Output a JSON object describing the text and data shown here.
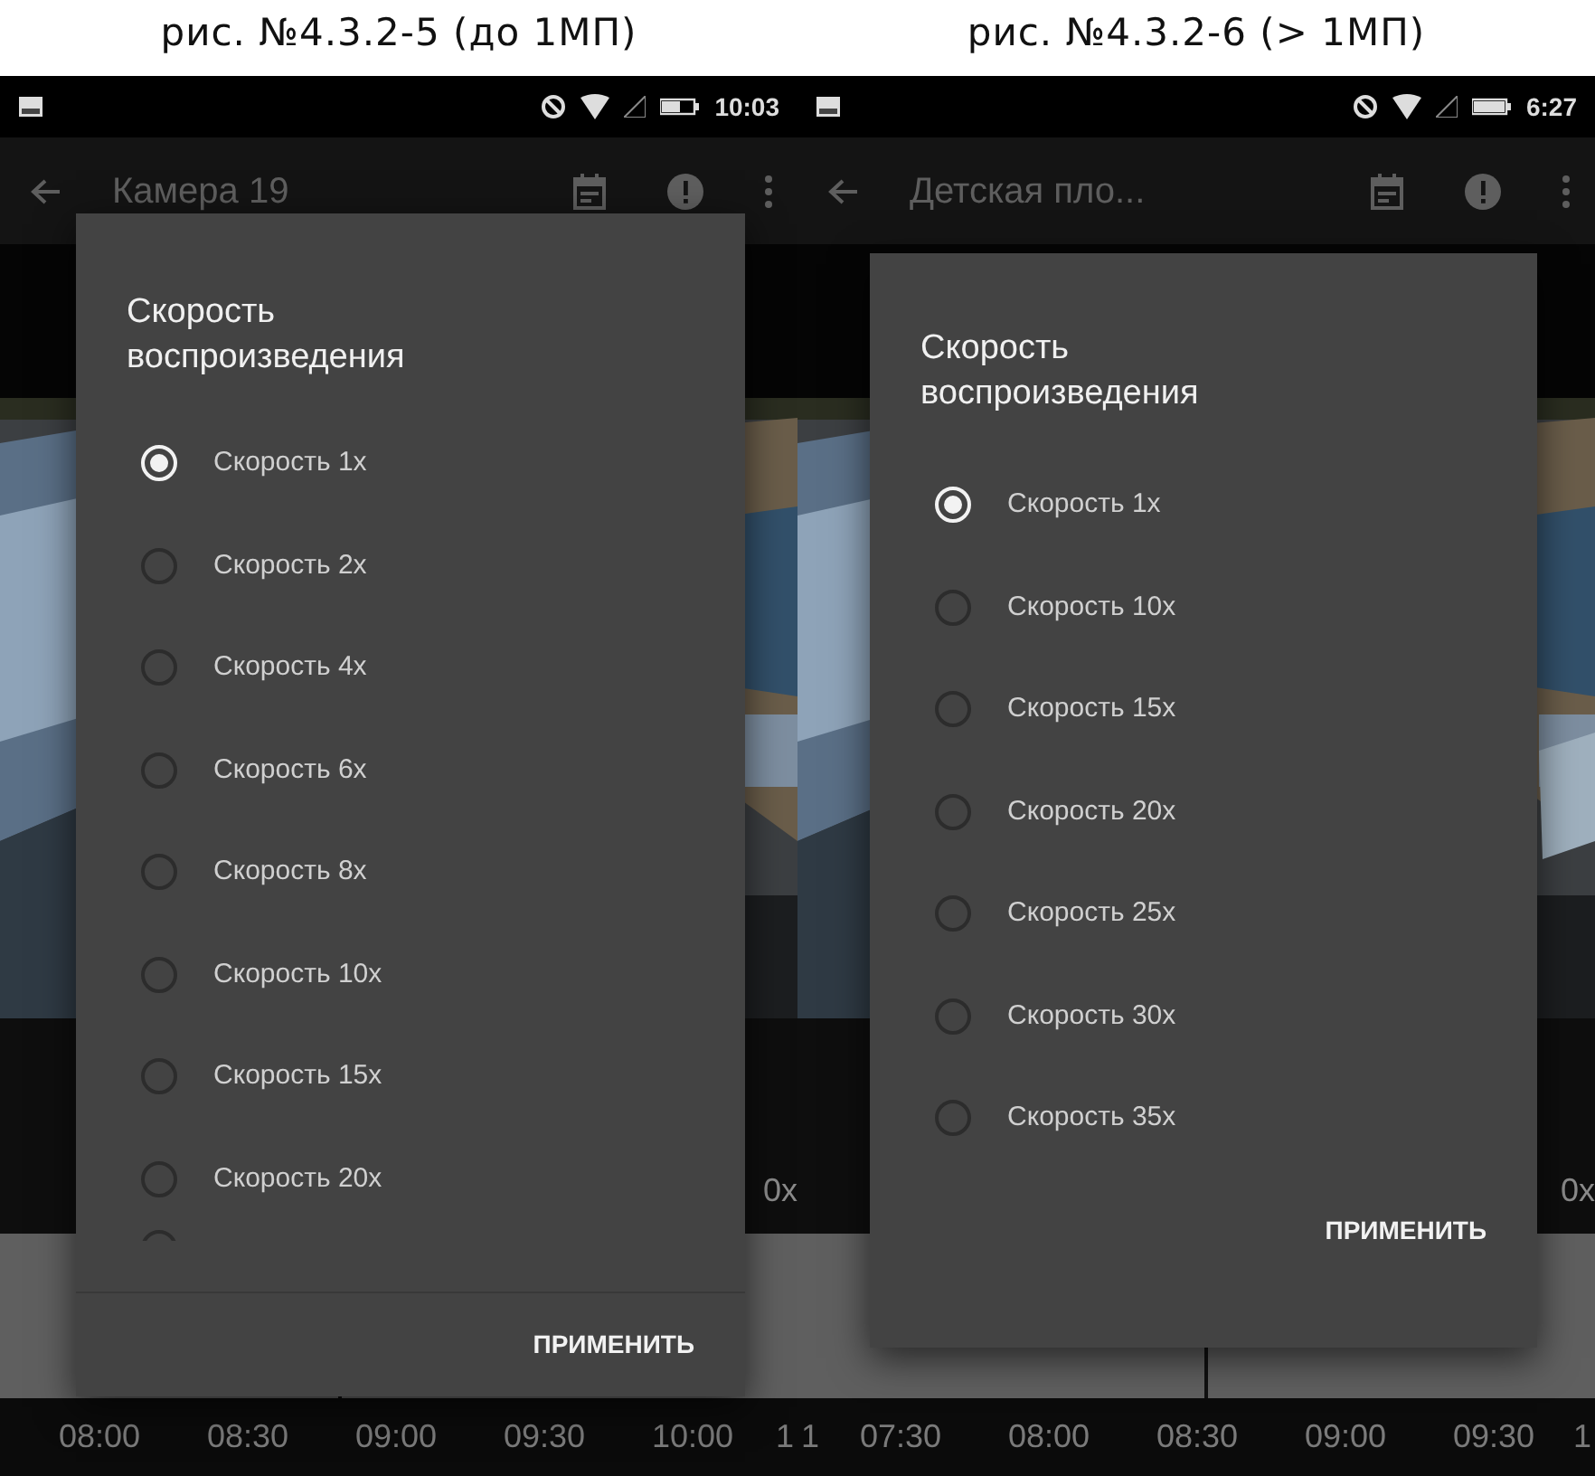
{
  "captions": [
    "рис. №4.3.2-5 (до 1МП)",
    "рис. №4.3.2-6 (> 1МП)"
  ],
  "screens": [
    {
      "status_bar": {
        "time": "10:03"
      },
      "app_bar": {
        "title": "Камера 19"
      },
      "speed_label": "0x",
      "timeline": {
        "labels": [
          "08:00",
          "08:30",
          "09:00",
          "09:30",
          "10:00"
        ],
        "trailing": "1"
      },
      "dialog": {
        "title": "Скорость воспроизведения",
        "more_below": true,
        "action": "ПРИМЕНИТЬ",
        "options": [
          {
            "label": "Скорость 1x",
            "selected": true
          },
          {
            "label": "Скорость 2x",
            "selected": false
          },
          {
            "label": "Скорость 4x",
            "selected": false
          },
          {
            "label": "Скорость 6x",
            "selected": false
          },
          {
            "label": "Скорость 8x",
            "selected": false
          },
          {
            "label": "Скорость 10x",
            "selected": false
          },
          {
            "label": "Скорость 15x",
            "selected": false
          },
          {
            "label": "Скорость 20x",
            "selected": false
          }
        ]
      }
    },
    {
      "status_bar": {
        "time": "6:27"
      },
      "app_bar": {
        "title": "Детская пло..."
      },
      "speed_label": "0x",
      "timeline": {
        "leading": "1",
        "labels": [
          "07:30",
          "08:00",
          "08:30",
          "09:00",
          "09:30"
        ],
        "trailing": "1"
      },
      "dialog": {
        "title": "Скорость воспроизведения",
        "more_below": false,
        "action": "ПРИМЕНИТЬ",
        "options": [
          {
            "label": "Скорость 1x",
            "selected": true
          },
          {
            "label": "Скорость 10x",
            "selected": false
          },
          {
            "label": "Скорость 15x",
            "selected": false
          },
          {
            "label": "Скорость 20x",
            "selected": false
          },
          {
            "label": "Скорость 25x",
            "selected": false
          },
          {
            "label": "Скорость 30x",
            "selected": false
          },
          {
            "label": "Скорость 35x",
            "selected": false
          }
        ]
      }
    }
  ]
}
